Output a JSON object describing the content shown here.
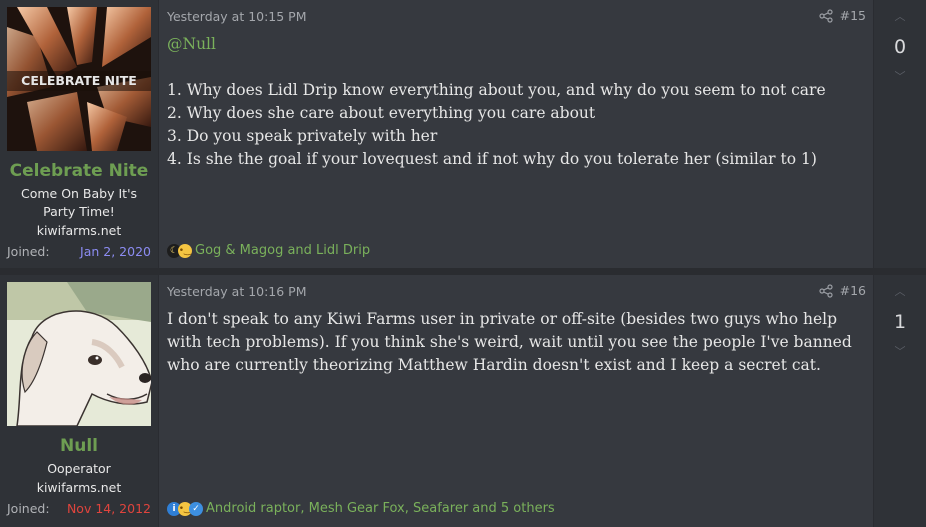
{
  "posts": [
    {
      "user": {
        "name": "Celebrate Nite",
        "title": "Come On Baby It's Party Time!",
        "site": "kiwifarms.net",
        "joined_label": "Joined:",
        "joined_date": "Jan 2, 2020",
        "joined_color": "#8c8cf2",
        "avatar_text": "CELEBRATE NITE"
      },
      "date": "Yesterday at 10:15 PM",
      "number": "#15",
      "mention": "@Null",
      "lines": [
        "1. Why does Lidl Drip know everything about you, and why do you seem to not care",
        "2. Why does she care about everything you care about",
        "3. Do you speak privately with her",
        "4. Is she the goal if your lovequest and if not why do you tolerate her (similar to 1)"
      ],
      "reactions": "Gog & Magog and Lidl Drip",
      "reaction_icons": [
        "moon-icon",
        "thinking-face-icon"
      ],
      "votes": "0"
    },
    {
      "user": {
        "name": "Null",
        "title": "Ooperator",
        "site": "kiwifarms.net",
        "joined_label": "Joined:",
        "joined_date": "Nov 14, 2012",
        "joined_color": "#e0443d"
      },
      "date": "Yesterday at 10:16 PM",
      "number": "#16",
      "body": "I don't speak to any Kiwi Farms user in private or off-site (besides two guys who help with tech problems). If you think she's weird, wait until you see the people I've banned who are currently theorizing Matthew Hardin doesn't exist and I keep a secret cat.",
      "reactions": "Android raptor, Mesh Gear Fox, Seafarer and 5 others",
      "reaction_icons": [
        "informative-icon",
        "thinking-face-icon",
        "thumbs-up-icon"
      ],
      "votes": "1"
    }
  ]
}
